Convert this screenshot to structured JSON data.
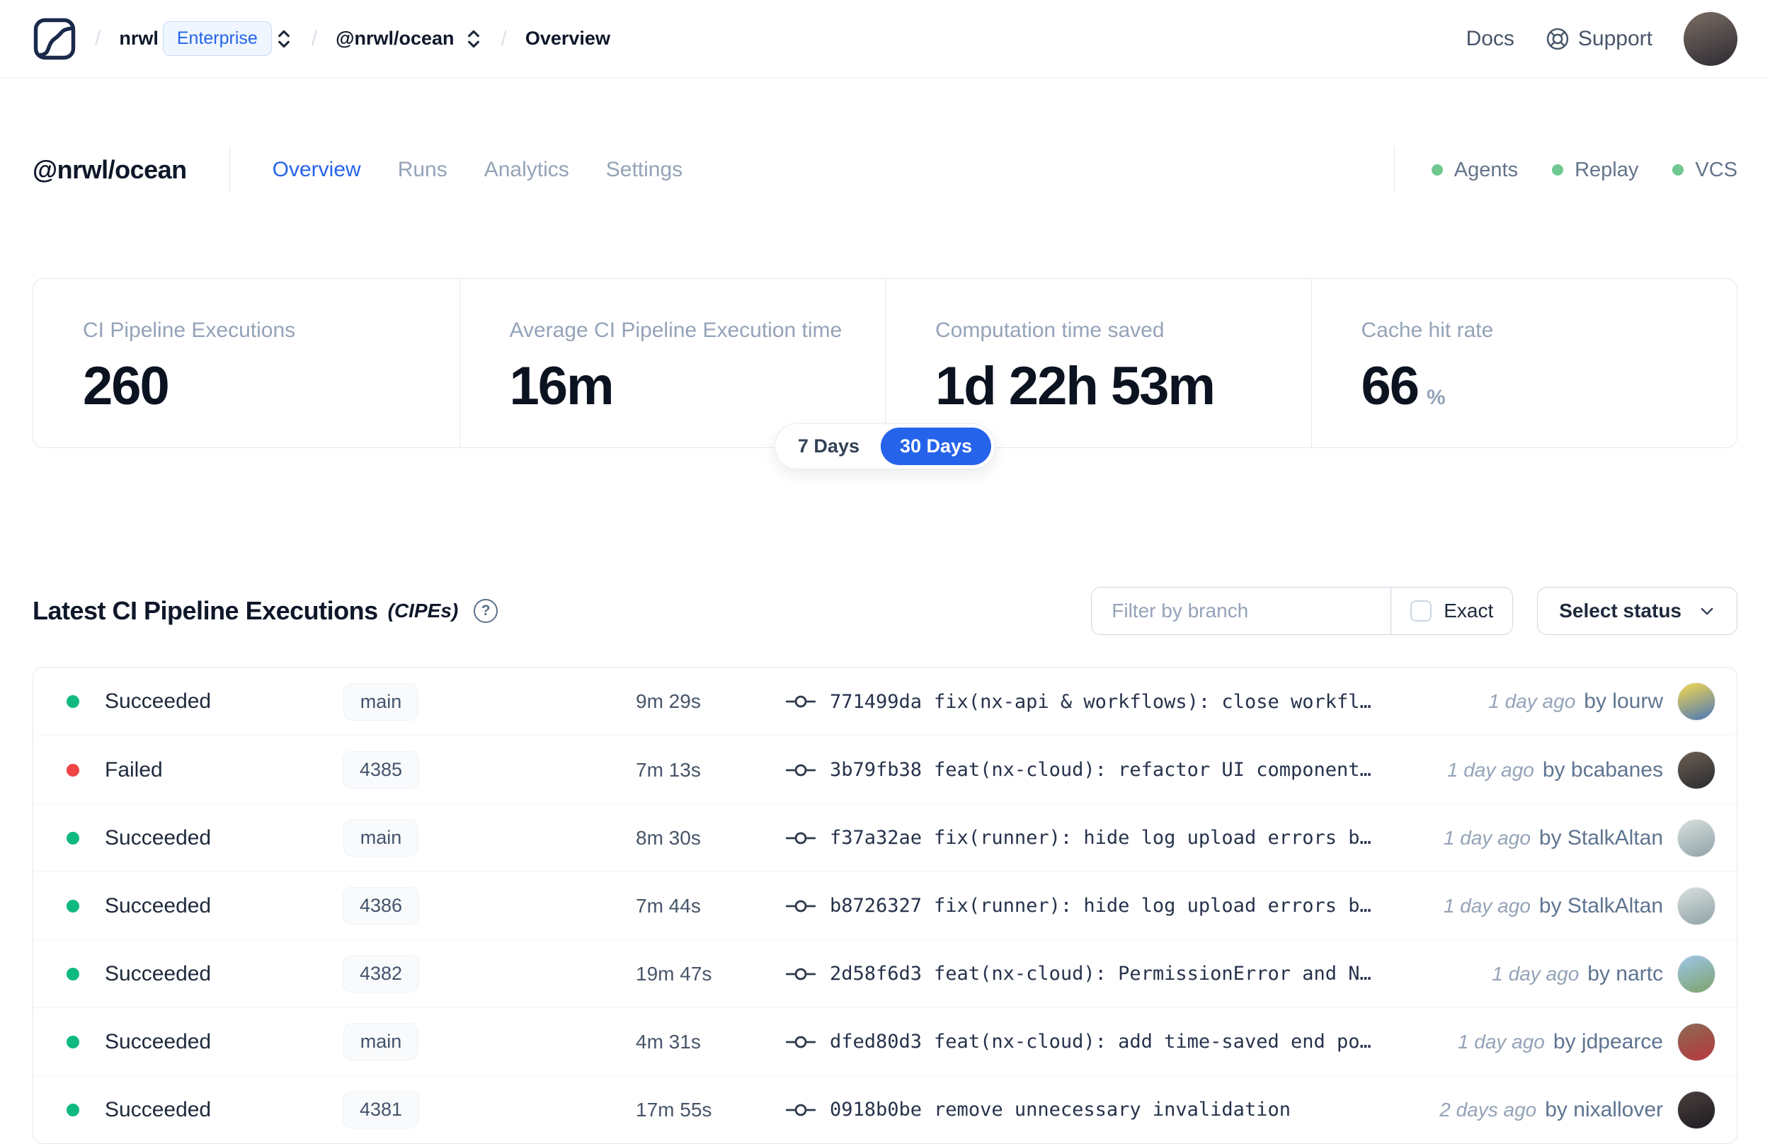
{
  "navbar": {
    "org": "nrwl",
    "org_badge": "Enterprise",
    "workspace": "@nrwl/ocean",
    "page": "Overview",
    "docs_label": "Docs",
    "support_label": "Support"
  },
  "workspace": {
    "title": "@nrwl/ocean",
    "tabs": [
      {
        "label": "Overview",
        "active": true
      },
      {
        "label": "Runs",
        "active": false
      },
      {
        "label": "Analytics",
        "active": false
      },
      {
        "label": "Settings",
        "active": false
      }
    ],
    "feature_links": [
      {
        "label": "Agents"
      },
      {
        "label": "Replay"
      },
      {
        "label": "VCS"
      }
    ]
  },
  "stats": {
    "cards": [
      {
        "label": "CI Pipeline Executions",
        "value": "260",
        "suffix": ""
      },
      {
        "label": "Average CI Pipeline Execution time",
        "value": "16m",
        "suffix": ""
      },
      {
        "label": "Computation time saved",
        "value": "1d 22h 53m",
        "suffix": ""
      },
      {
        "label": "Cache hit rate",
        "value": "66",
        "suffix": "%"
      }
    ],
    "range_toggle": {
      "options": [
        "7 Days",
        "30 Days"
      ],
      "selected": "30 Days"
    }
  },
  "cipe_section": {
    "title": "Latest CI Pipeline Executions",
    "title_suffix": "(CIPEs)",
    "help_glyph": "?",
    "filter_placeholder": "Filter by branch",
    "exact_label": "Exact",
    "status_dropdown_label": "Select status",
    "rows": [
      {
        "status": "Succeeded",
        "status_color": "#10b981",
        "branch": "main",
        "duration": "9m 29s",
        "commit_hash": "771499da",
        "commit_message": "fix(nx-api & workflows): close workfl…",
        "time_ago": "1 day ago",
        "author": "by lourw",
        "avatar_colors": [
          "#f5d94e",
          "#4a76b8"
        ]
      },
      {
        "status": "Failed",
        "status_color": "#ef4444",
        "branch": "4385",
        "duration": "7m 13s",
        "commit_hash": "3b79fb38",
        "commit_message": "feat(nx-cloud): refactor UI component…",
        "time_ago": "1 day ago",
        "author": "by bcabanes",
        "avatar_colors": [
          "#6b5e52",
          "#2b2b30"
        ]
      },
      {
        "status": "Succeeded",
        "status_color": "#10b981",
        "branch": "main",
        "duration": "8m 30s",
        "commit_hash": "f37a32ae",
        "commit_message": "fix(runner): hide log upload errors b…",
        "time_ago": "1 day ago",
        "author": "by StalkAltan",
        "avatar_colors": [
          "#d8dfdc",
          "#8fa3a8"
        ]
      },
      {
        "status": "Succeeded",
        "status_color": "#10b981",
        "branch": "4386",
        "duration": "7m 44s",
        "commit_hash": "b8726327",
        "commit_message": "fix(runner): hide log upload errors b…",
        "time_ago": "1 day ago",
        "author": "by StalkAltan",
        "avatar_colors": [
          "#d8dfdc",
          "#8fa3a8"
        ]
      },
      {
        "status": "Succeeded",
        "status_color": "#10b981",
        "branch": "4382",
        "duration": "19m 47s",
        "commit_hash": "2d58f6d3",
        "commit_message": "feat(nx-cloud): PermissionError and N…",
        "time_ago": "1 day ago",
        "author": "by nartc",
        "avatar_colors": [
          "#9ec7e8",
          "#7da26b"
        ]
      },
      {
        "status": "Succeeded",
        "status_color": "#10b981",
        "branch": "main",
        "duration": "4m 31s",
        "commit_hash": "dfed80d3",
        "commit_message": "feat(nx-cloud): add time-saved end po…",
        "time_ago": "1 day ago",
        "author": "by jdpearce",
        "avatar_colors": [
          "#8a6a52",
          "#b8373f"
        ]
      },
      {
        "status": "Succeeded",
        "status_color": "#10b981",
        "branch": "4381",
        "duration": "17m 55s",
        "commit_hash": "0918b0be",
        "commit_message": "remove unnecessary invalidation",
        "time_ago": "2 days ago",
        "author": "by nixallover",
        "avatar_colors": [
          "#4a3f3c",
          "#1f1c22"
        ]
      }
    ]
  },
  "colors": {
    "accent": "#2563eb",
    "success": "#10b981",
    "failed": "#ef4444",
    "feature_dot": "#6fc890",
    "nav_avatar": [
      "#7a6d63",
      "#2e2a33"
    ]
  }
}
